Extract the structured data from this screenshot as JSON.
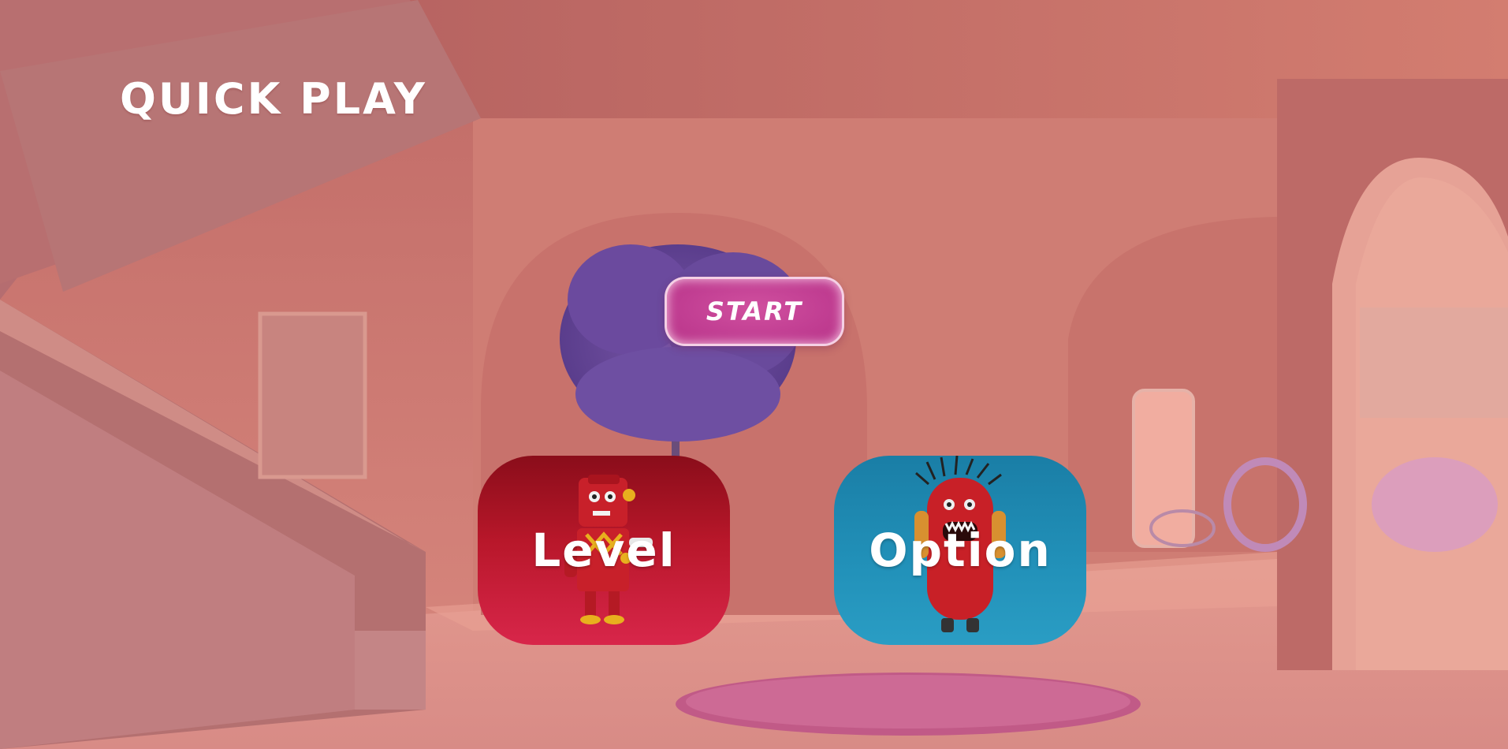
{
  "header": {
    "title": "QUICK PLAY"
  },
  "main": {
    "start_label": "START",
    "cards": [
      {
        "label": "Level",
        "character": "red robot",
        "accent": "#c0182c"
      },
      {
        "label": "Option",
        "character": "red furry monster",
        "accent": "#2190b8"
      }
    ]
  },
  "colors": {
    "background": "#c67a72",
    "start_button": "#c23f93",
    "text": "#ffffff"
  }
}
